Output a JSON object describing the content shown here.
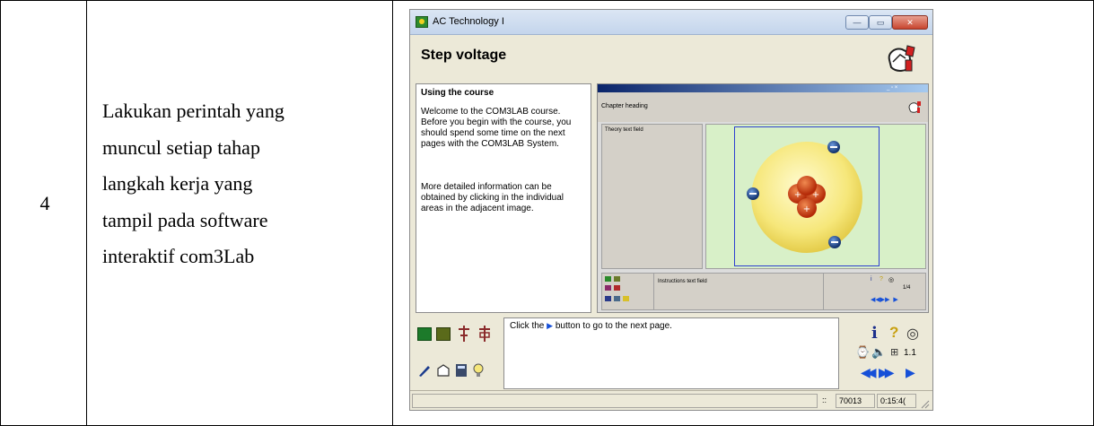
{
  "row": {
    "number": "4",
    "instruction_lines": [
      "Lakukan perintah yang",
      "muncul setiap tahap",
      "langkah kerja yang",
      "tampil pada software",
      "interaktif com3Lab"
    ]
  },
  "window": {
    "title": "AC Technology I",
    "min_label": "—",
    "max_label": "▭",
    "close_label": "✕"
  },
  "page": {
    "heading": "Step voltage"
  },
  "theory": {
    "title": "Using the course",
    "paragraph_1": "Welcome to the COM3LAB course. Before you begin with the course, you should spend some time on the next pages with the COM3LAB System.",
    "paragraph_2": "More detailed information can be obtained by clicking in the individual areas in the adjacent image."
  },
  "demo": {
    "chapter_heading": "Chapter heading",
    "theory_field": "Theory text field",
    "instructions_field": "Instructions text field",
    "page_label": "1/4",
    "window_buttons": "_ ▫ ×"
  },
  "instructions": {
    "before": "Click the",
    "after": "button to go to the next page."
  },
  "nav": {
    "page_number": "1.1"
  },
  "status": {
    "cell_1": "",
    "marker": "::",
    "code": "70013",
    "time": "0:15:4("
  },
  "colors": {
    "accent_blue": "#1650d8",
    "sim_background": "#d8f0c8",
    "nucleus_red": "#d03a10",
    "electron_blue": "#1c4fa0"
  }
}
